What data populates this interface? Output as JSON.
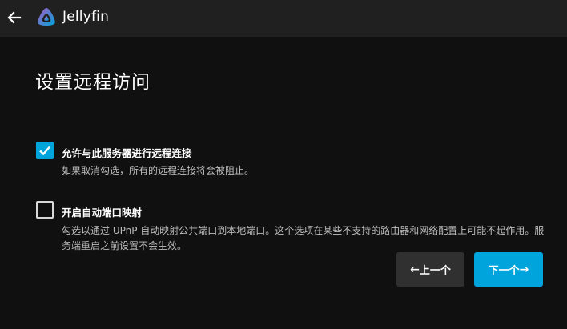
{
  "app": {
    "title": "Jellyfin"
  },
  "header": {
    "back_icon": "arrow-left-icon",
    "logo_icon": "jellyfin-logo"
  },
  "page": {
    "title": "设置远程访问"
  },
  "options": [
    {
      "label": "允许与此服务器进行远程连接",
      "description": "如果取消勾选，所有的远程连接将会被阻止。",
      "checked": true
    },
    {
      "label": "开启自动端口映射",
      "description": "勾选以通过 UPnP 自动映射公共端口到本地端口。这个选项在某些不支持的路由器和网络配置上可能不起作用。服务端重启之前设置不会生效。",
      "checked": false
    }
  ],
  "buttons": {
    "prev_label": "上一个",
    "next_label": "下一个"
  },
  "colors": {
    "accent": "#00a4dc",
    "background": "#101010",
    "topbar": "#202020",
    "button_secondary": "#303030"
  }
}
